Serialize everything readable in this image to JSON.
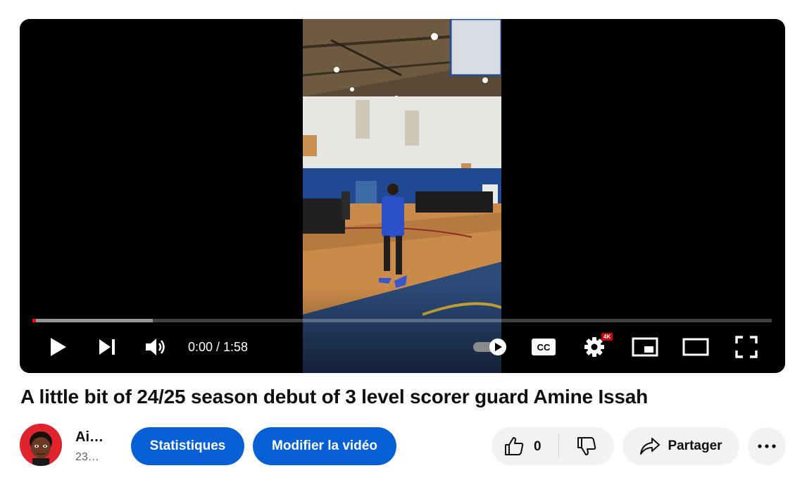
{
  "player": {
    "time_display": "0:00 / 1:58",
    "progress_played_fraction": 0.003,
    "progress_buffered_fraction": 0.163,
    "quality_badge": "4K",
    "accent_color": "#ff0000"
  },
  "video": {
    "title": "A little bit of 24/25 season debut of 3 level scorer guard Amine Issah"
  },
  "channel": {
    "name": "Ai…",
    "subscribers": "23…"
  },
  "actions": {
    "stats_label": "Statistiques",
    "edit_label": "Modifier la vidéo",
    "like_count": "0",
    "share_label": "Partager",
    "primary_color": "#065fd4"
  },
  "icons": [
    "play-icon",
    "next-icon",
    "volume-icon",
    "autoplay-toggle-icon",
    "subtitles-icon",
    "settings-icon",
    "miniplayer-icon",
    "theater-mode-icon",
    "fullscreen-icon",
    "like-icon",
    "dislike-icon",
    "share-icon",
    "more-icon"
  ]
}
